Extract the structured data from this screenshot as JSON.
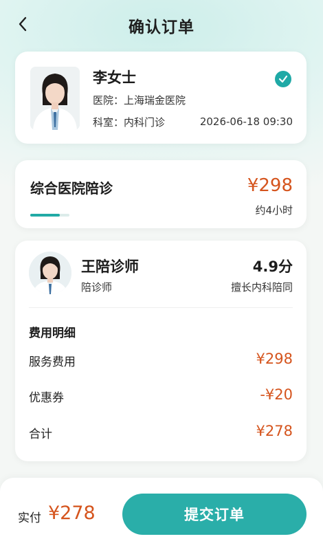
{
  "header": {
    "title": "确认订单"
  },
  "doctor": {
    "name": "李女士",
    "hospital": "医院：上海瑞金医院",
    "department": "科室：内科门诊",
    "datetime": "2026-06-18 09:30",
    "selected": true
  },
  "service": {
    "name": "综合医院陪诊",
    "price": "¥298",
    "duration": "约4小时",
    "progress": 0.75
  },
  "escort": {
    "name": "王陪诊师",
    "role": "陪诊师",
    "score": "4.9分",
    "specialty": "擅长内科陪同"
  },
  "fees": {
    "title": "费用明细",
    "rows": [
      {
        "label": "服务费用",
        "value": "¥298"
      },
      {
        "label": "优惠券",
        "value": "-¥20"
      },
      {
        "label": "合计",
        "value": "¥278"
      }
    ]
  },
  "footer": {
    "pay_label": "实付",
    "pay_amount": "¥278",
    "submit_label": "提交订单"
  },
  "colors": {
    "accent": "#2aaea9",
    "price": "#d5541d"
  }
}
